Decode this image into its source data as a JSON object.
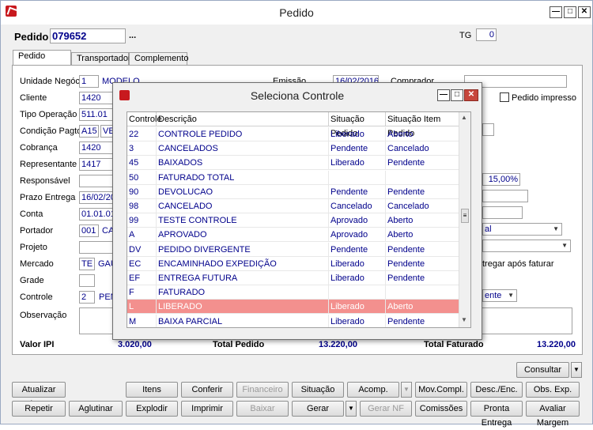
{
  "window": {
    "title": "Pedido"
  },
  "header": {
    "pedido_label": "Pedido",
    "pedido_value": "079652",
    "lookup": "...",
    "tg_label": "TG",
    "tg_value": "0"
  },
  "tabs": [
    "Pedido",
    "Transportadora",
    "Complemento"
  ],
  "form": {
    "labels": [
      "Unidade Negócio",
      "Cliente",
      "Tipo Operação",
      "Condição Pagto.",
      "Cobrança",
      "Representante",
      "Responsável",
      "Prazo Entrega",
      "Conta",
      "Portador",
      "Projeto",
      "Mercado",
      "Grade",
      "Controle",
      "Observação"
    ],
    "unidade": "1",
    "unidade_name": "MODELO",
    "cliente": "1420",
    "tipo_operacao": "511.01",
    "condicao": "A15",
    "condicao_name": "VEN",
    "cobranca": "1420",
    "representante": "1417",
    "prazo": "16/02/20",
    "conta": "01.01.01",
    "portador": "001",
    "portador_name": "CA",
    "mercado": "TE",
    "mercado_name": "GAÚ",
    "controle": "2",
    "controle_name": "PEN",
    "emissao_label": "Emissão",
    "emissao_value": "16/02/2016",
    "comprador_label": "Comprador",
    "pedido_impresso": "Pedido impresso",
    "percent": "15,00%",
    "sel1": "al",
    "sel3": "ente",
    "entregar": "tregar após faturar"
  },
  "totals": {
    "valor_ipi_label": "Valor IPI",
    "valor_ipi": "3.020,00",
    "total_pedido_label": "Total Pedido",
    "total_pedido": "13.220,00",
    "total_faturado_label": "Total Faturado",
    "total_faturado": "13.220,00"
  },
  "buttons": {
    "consultar": "Consultar",
    "row1": [
      "Atualizar Imp.",
      "Itens",
      "Conferir",
      "Financeiro",
      "Situação",
      "Acomp.",
      "Mov.Compl.",
      "Desc./Enc.",
      "Obs. Exp."
    ],
    "row2": [
      "Repetir",
      "Aglutinar",
      "Explodir",
      "Imprimir",
      "Baixar",
      "Gerar",
      "Gerar NF",
      "Comissões",
      "Pronta Entrega",
      "Avaliar Margem"
    ]
  },
  "modal": {
    "title": "Seleciona Controle",
    "columns": [
      "Controle",
      "Descrição",
      "Situação Pedido",
      "Situação Item Pedido"
    ],
    "rows": [
      [
        "22",
        "CONTROLE PEDIDO",
        "Liberado",
        "Aberto"
      ],
      [
        "3",
        "CANCELADOS",
        "Pendente",
        "Cancelado"
      ],
      [
        "45",
        "BAIXADOS",
        "Liberado",
        "Pendente"
      ],
      [
        "50",
        "FATURADO TOTAL",
        "",
        ""
      ],
      [
        "90",
        "DEVOLUCAO",
        "Pendente",
        "Pendente"
      ],
      [
        "98",
        "CANCELADO",
        "Cancelado",
        "Cancelado"
      ],
      [
        "99",
        "TESTE CONTROLE",
        "Aprovado",
        "Aberto"
      ],
      [
        "A",
        "APROVADO",
        "Aprovado",
        "Aberto"
      ],
      [
        "DV",
        "PEDIDO DIVERGENTE",
        "Pendente",
        "Pendente"
      ],
      [
        "EC",
        "ENCAMINHADO EXPEDIÇÃO",
        "Liberado",
        "Pendente"
      ],
      [
        "EF",
        "ENTREGA FUTURA",
        "Liberado",
        "Pendente"
      ],
      [
        "F",
        "FATURADO",
        "",
        ""
      ],
      [
        "L",
        "LIBERADO",
        "Liberado",
        "Aberto"
      ],
      [
        "M",
        "BAIXA PARCIAL",
        "Liberado",
        "Pendente"
      ]
    ],
    "selected_row": 12
  }
}
